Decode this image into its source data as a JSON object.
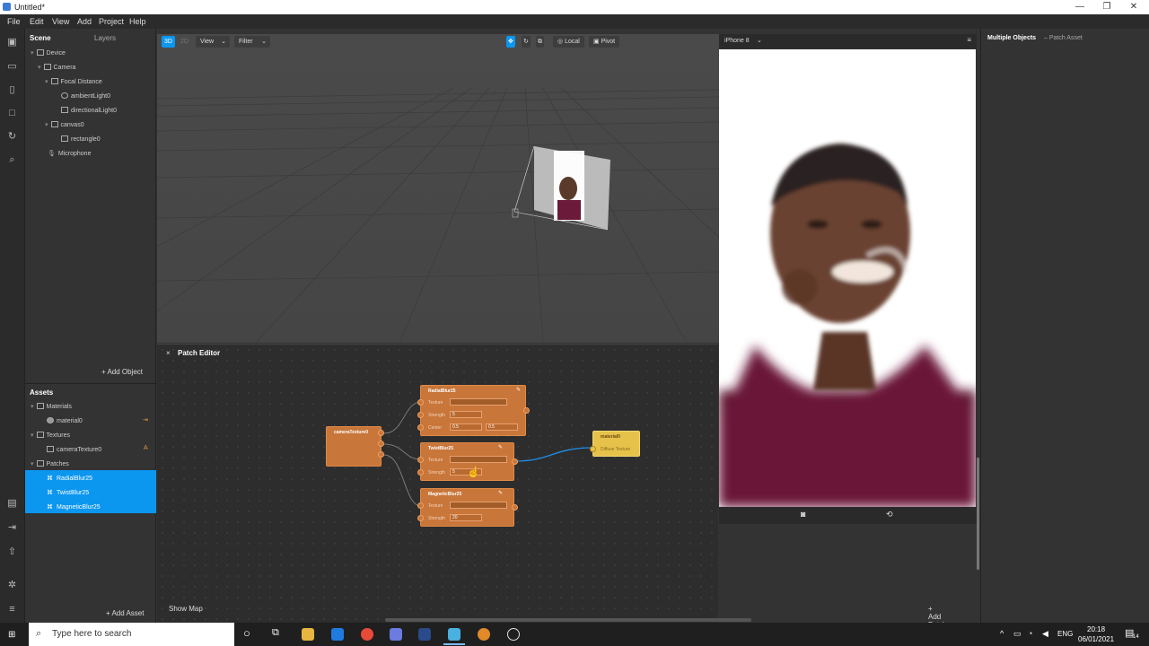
{
  "window": {
    "title": "Untitled*",
    "minimize": "—",
    "restore": "❐",
    "close": "✕"
  },
  "menu": [
    "File",
    "Edit",
    "View",
    "Add",
    "Project",
    "Help"
  ],
  "scene_panel": {
    "tabs": [
      "Scene",
      "Layers"
    ],
    "tree": [
      "Device",
      "Camera",
      "Focal Distance",
      "ambientLight0",
      "directionalLight0",
      "canvas0",
      "rectangle0",
      "Microphone"
    ],
    "add_object": "Add Object"
  },
  "assets_panel": {
    "title": "Assets",
    "items": [
      "Materials",
      "material0",
      "Textures",
      "cameraTexture0",
      "Patches",
      "RadialBlur25",
      "TwistBlur25",
      "MagneticBlur25"
    ],
    "add_asset": "Add Asset"
  },
  "viewport_toolbar": {
    "mode_3d": "3D",
    "mode_2d": "2D",
    "view": "View",
    "filter": "Filter",
    "local": "Local",
    "pivot": "Pivot"
  },
  "patch_editor": {
    "title": "Patch Editor",
    "show_map": "Show Map",
    "add_patch": "Add Patch",
    "nodes": {
      "camera": {
        "title": "cameraTexture0"
      },
      "radial": {
        "title": "RadialBlur25",
        "texture": "Texture",
        "strength_label": "Strength",
        "strength": "5",
        "center_label": "Center",
        "center_x": "0.5",
        "center_y": "0.5"
      },
      "twist": {
        "title": "TwistBlur25",
        "texture": "Texture",
        "strength_label": "Strength",
        "strength": "5"
      },
      "magnetic": {
        "title": "MagneticBlur25",
        "texture": "Texture",
        "strength_label": "Strength",
        "strength": "20"
      },
      "material": {
        "title": "material0",
        "port": "Diffuse Texture"
      }
    }
  },
  "device": {
    "name": "iPhone 8"
  },
  "right_panel": {
    "title": "Multiple Objects",
    "subtitle": "– Patch Asset"
  },
  "taskbar": {
    "search_placeholder": "Type here to search",
    "lang": "ENG",
    "time": "20:18",
    "date": "06/01/2021",
    "notif": "14"
  },
  "colors": {
    "accent": "#0b96f0",
    "patch_node": "#c8763a",
    "material_node": "#e6c24a"
  }
}
